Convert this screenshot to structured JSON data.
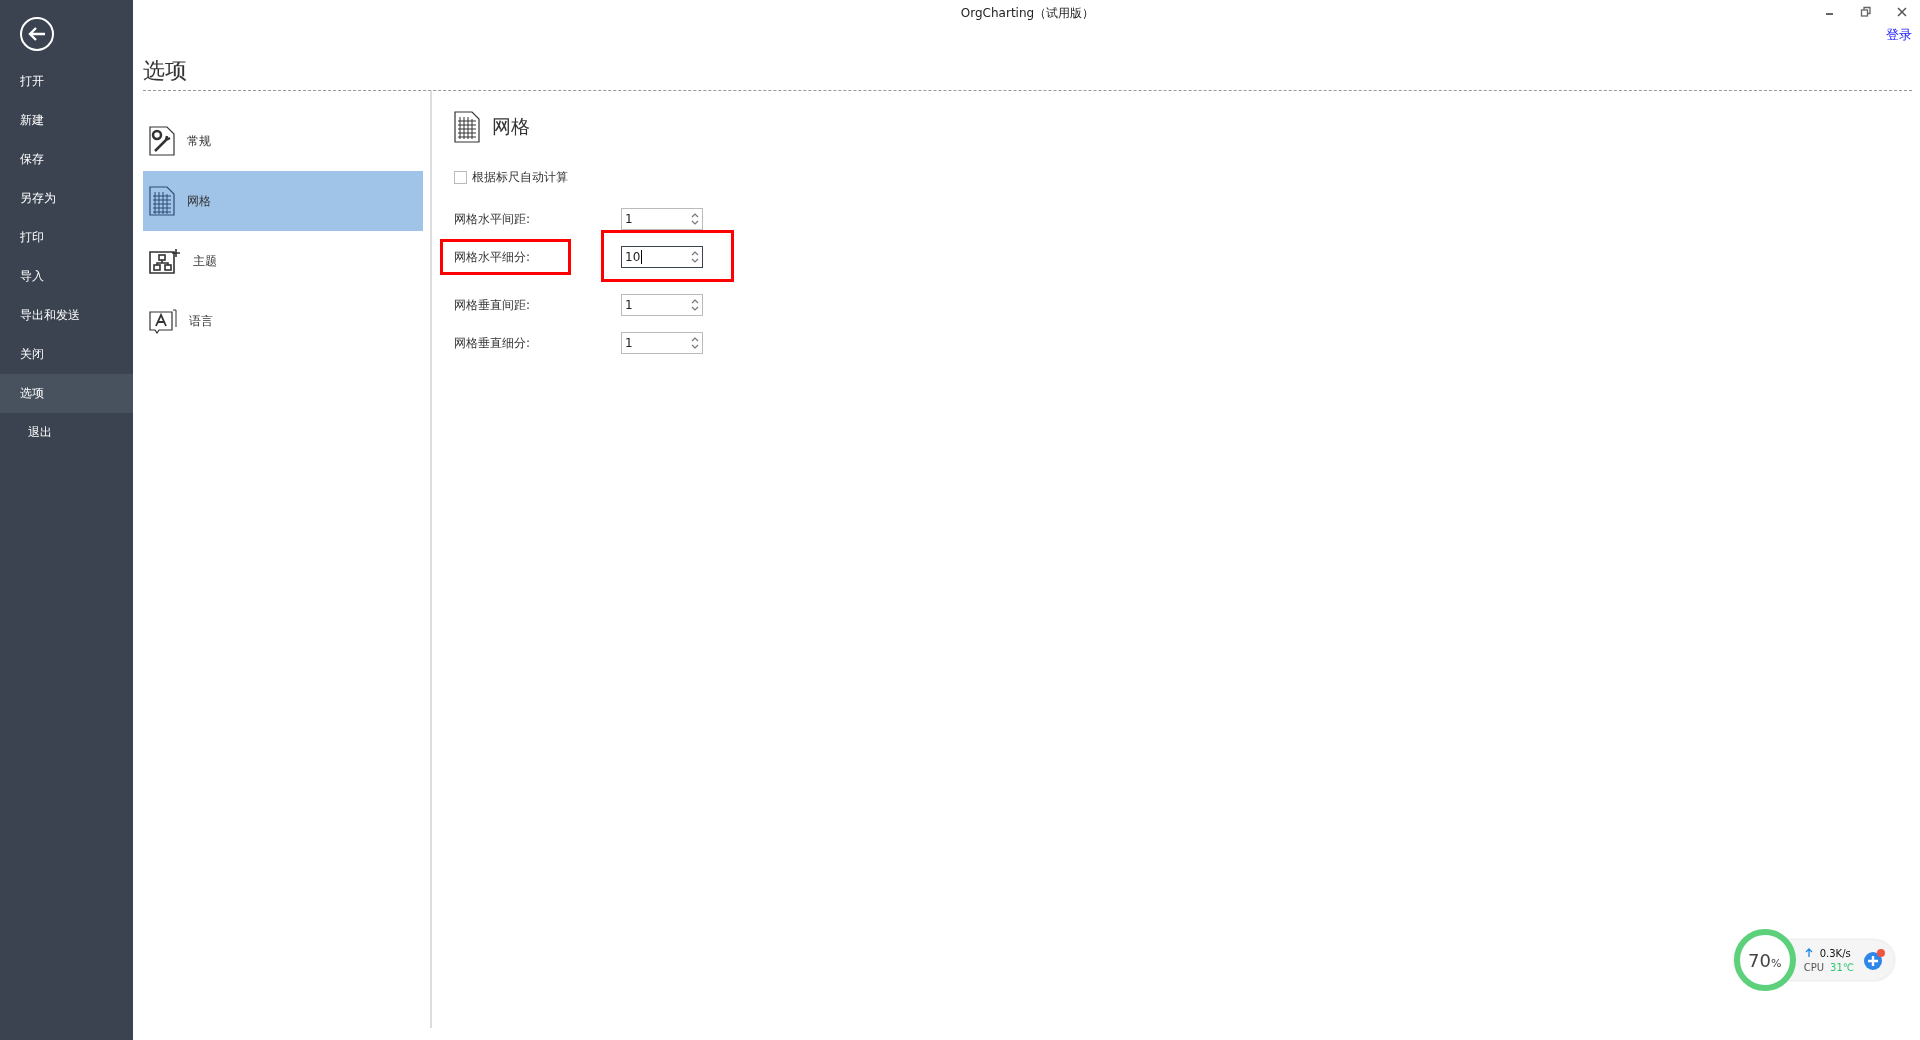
{
  "window": {
    "title": "OrgCharting（试用版）",
    "login": "登录"
  },
  "nav": [
    {
      "label": "打开",
      "selected": false
    },
    {
      "label": "新建",
      "selected": false
    },
    {
      "label": "保存",
      "selected": false
    },
    {
      "label": "另存为",
      "selected": false
    },
    {
      "label": "打印",
      "selected": false
    },
    {
      "label": "导入",
      "selected": false
    },
    {
      "label": "导出和发送",
      "selected": false
    },
    {
      "label": "关闭",
      "selected": false
    },
    {
      "label": "选项",
      "selected": true
    },
    {
      "label": "退出",
      "selected": false
    }
  ],
  "page_title": "选项",
  "categories": [
    {
      "label": "常规",
      "kind": "general",
      "selected": false
    },
    {
      "label": "网格",
      "kind": "grid",
      "selected": true
    },
    {
      "label": "主题",
      "kind": "theme",
      "selected": false
    },
    {
      "label": "语言",
      "kind": "language",
      "selected": false
    }
  ],
  "panel": {
    "title": "网格",
    "auto_calc": {
      "label": "根据标尺自动计算",
      "checked": false
    },
    "fields": [
      {
        "label": "网格水平间距:",
        "value": "1",
        "focused": false,
        "highlighted": false
      },
      {
        "label": "网格水平细分:",
        "value": "10",
        "focused": true,
        "highlighted": true
      },
      {
        "label": "网格垂直间距:",
        "value": "1",
        "focused": false,
        "highlighted": false
      },
      {
        "label": "网格垂直细分:",
        "value": "1",
        "focused": false,
        "highlighted": false
      }
    ]
  },
  "monitor": {
    "percent": "70",
    "unit": "%",
    "speed": "0.3K/s",
    "cpu_label": "CPU",
    "cpu_temp": "31℃"
  }
}
